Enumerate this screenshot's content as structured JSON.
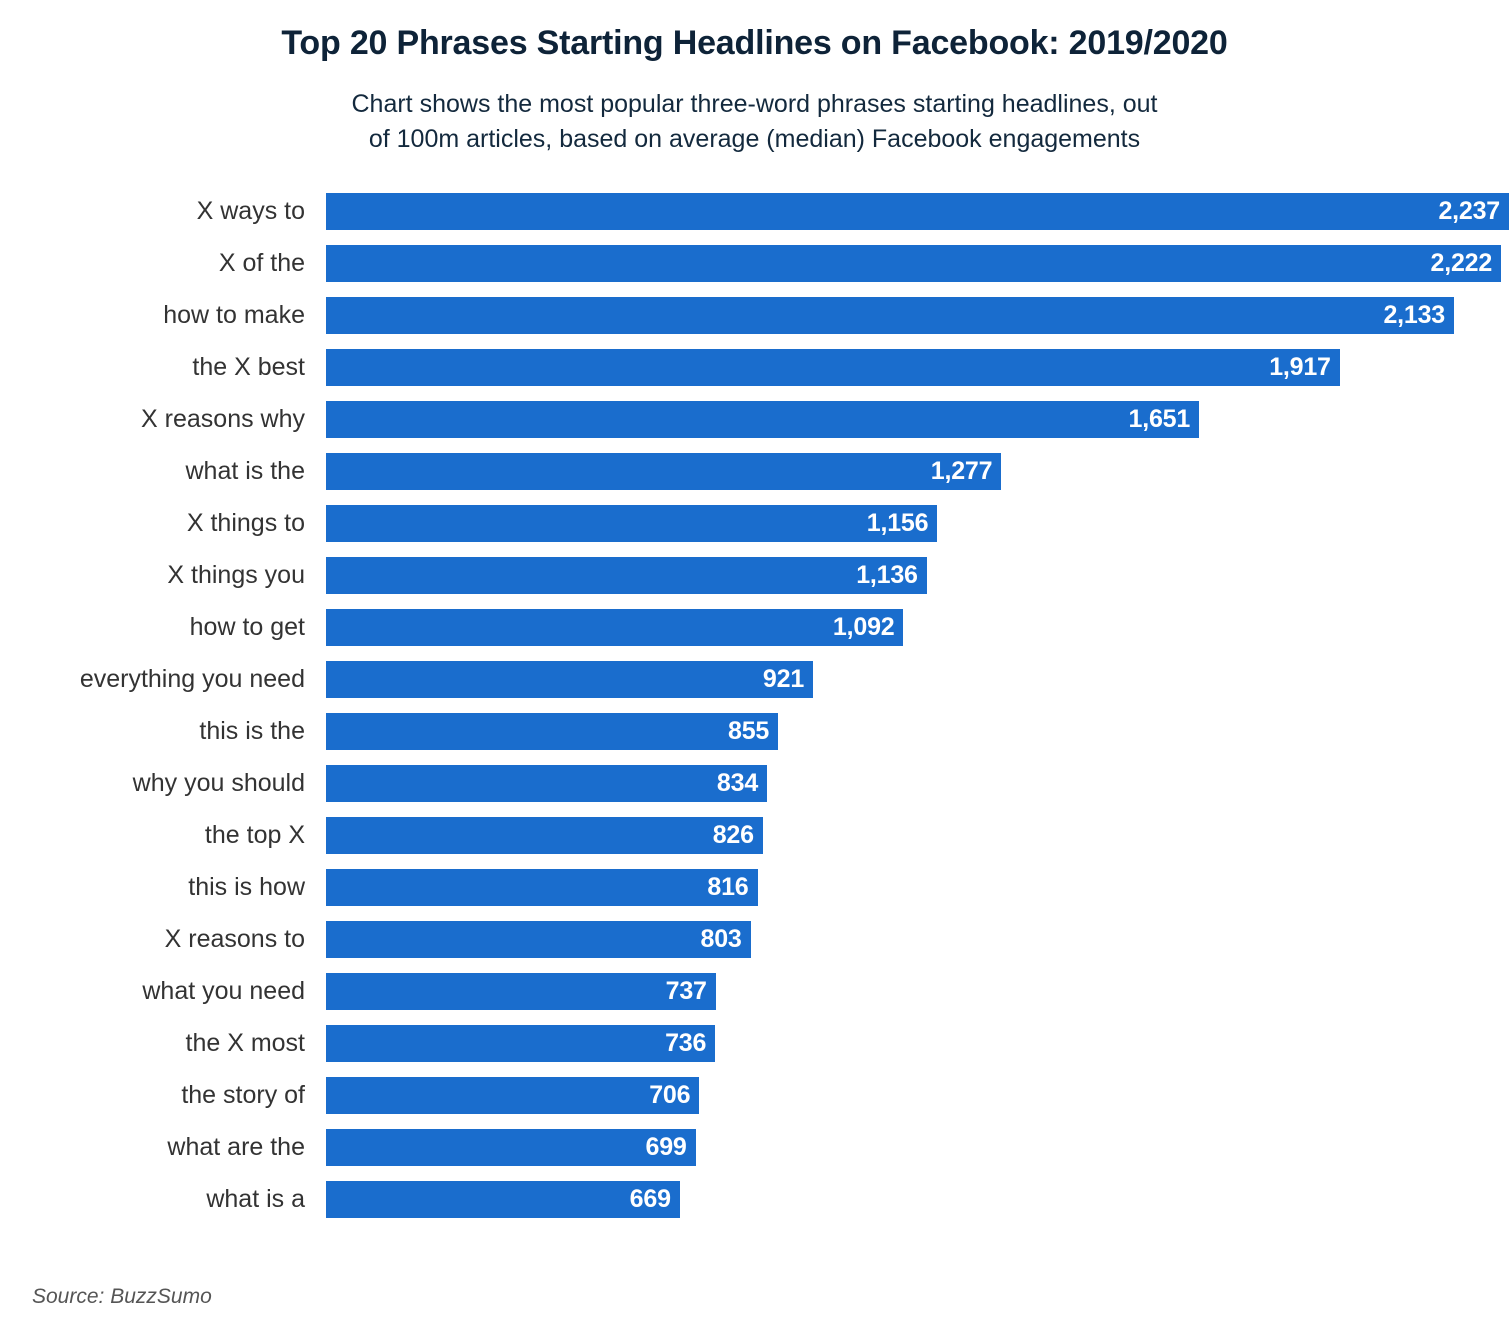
{
  "header": {
    "title": "Top 20 Phrases Starting Headlines on Facebook: 2019/2020",
    "subtitle_line1": "Chart shows the most popular three-word phrases starting headlines, out",
    "subtitle_line2": "of 100m articles, based on average (median) Facebook engagements"
  },
  "footer": {
    "source": "Source: BuzzSumo"
  },
  "colors": {
    "bar": "#1A6DCD",
    "title": "#0E2338",
    "subtitle": "#13293D",
    "category_label": "#333333",
    "value_label": "#FFFFFF",
    "background": "#FFFFFF",
    "source": "#555555"
  },
  "chart_data": {
    "type": "bar",
    "orientation": "horizontal",
    "title": "Top 20 Phrases Starting Headlines on Facebook: 2019/2020",
    "subtitle": "Chart shows the most popular three-word phrases starting headlines, out of 100m articles, based on average (median) Facebook engagements",
    "xlabel": "",
    "ylabel": "",
    "xlim": [
      0,
      2237
    ],
    "grid": false,
    "legend": false,
    "value_format": "comma-separated integer",
    "categories": [
      "X ways to",
      "X of the",
      "how to make",
      "the X best",
      "X reasons why",
      "what is the",
      "X things to",
      "X things you",
      "how to get",
      "everything you need",
      "this is the",
      "why you should",
      "the top X",
      "this is how",
      "X reasons to",
      "what you need",
      "the X most",
      "the story of",
      "what are the",
      "what is a"
    ],
    "values": [
      2237,
      2222,
      2133,
      1917,
      1651,
      1277,
      1156,
      1136,
      1092,
      921,
      855,
      834,
      826,
      816,
      803,
      737,
      736,
      706,
      699,
      669
    ],
    "value_labels": [
      "2,237",
      "2,222",
      "2,133",
      "1,917",
      "1,651",
      "1,277",
      "1,156",
      "1,136",
      "1,092",
      "921",
      "855",
      "834",
      "826",
      "816",
      "803",
      "737",
      "736",
      "706",
      "699",
      "669"
    ]
  }
}
